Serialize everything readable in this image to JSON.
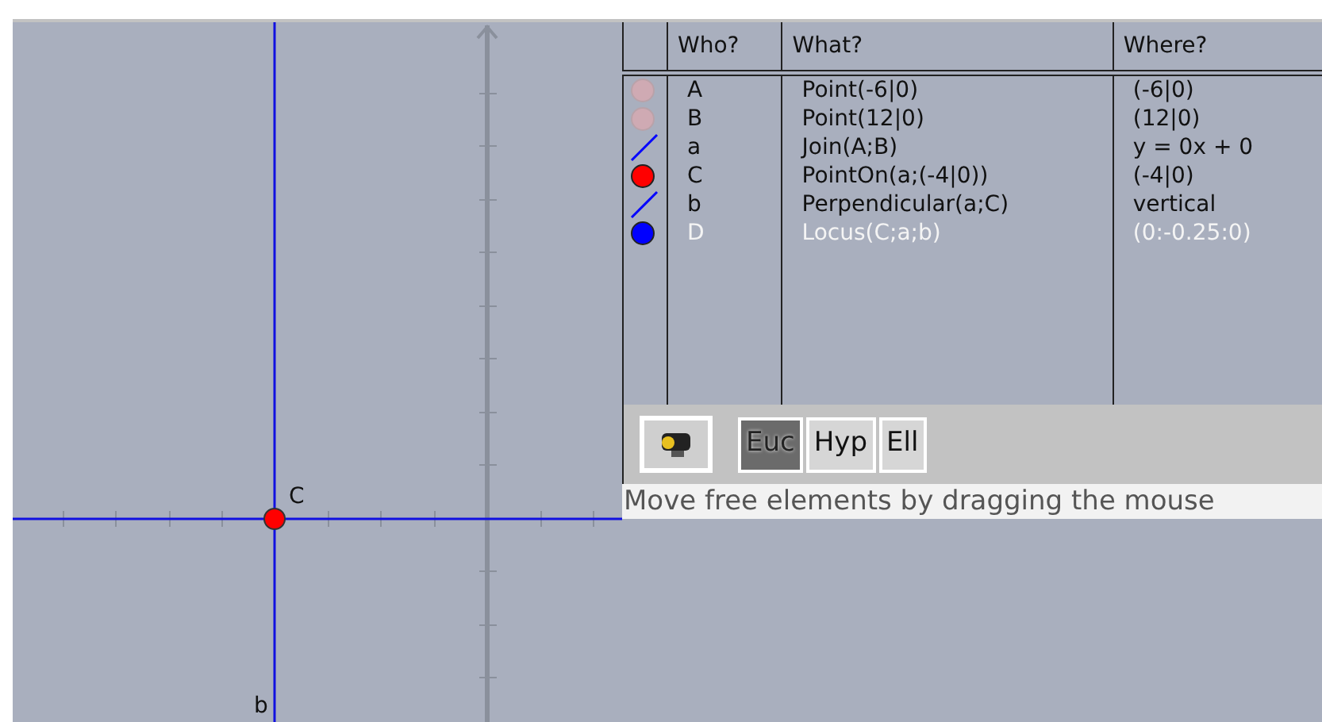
{
  "table": {
    "columns": [
      "Who?",
      "What?",
      "Where?"
    ],
    "rows": [
      {
        "kind": "point",
        "color": "#cfaab3",
        "who": "A",
        "what": "Point(-6|0)",
        "where": "(-6|0)",
        "highlighted": false
      },
      {
        "kind": "point",
        "color": "#cfaab3",
        "who": "B",
        "what": "Point(12|0)",
        "where": "(12|0)",
        "highlighted": false
      },
      {
        "kind": "line",
        "color": "#0000ff",
        "who": "a",
        "what": "Join(A;B)",
        "where": "y = 0x  + 0",
        "highlighted": false
      },
      {
        "kind": "point",
        "color": "#ff0000",
        "who": "C",
        "what": "PointOn(a;(-4|0))",
        "where": "(-4|0)",
        "highlighted": false
      },
      {
        "kind": "line",
        "color": "#0000ff",
        "who": "b",
        "what": "Perpendicular(a;C)",
        "where": "vertical",
        "highlighted": false
      },
      {
        "kind": "point",
        "color": "#0000ff",
        "who": "D",
        "what": "Locus(C;a;b)",
        "where": "(0:-0.25:0)",
        "highlighted": true
      }
    ]
  },
  "geometry_buttons": [
    {
      "label": "Euc",
      "selected": true
    },
    {
      "label": "Hyp",
      "selected": false
    },
    {
      "label": "Ell",
      "selected": false
    }
  ],
  "status_bar": "Move free elements by dragging the mouse",
  "canvas": {
    "labels": [
      {
        "text": "C"
      },
      {
        "text": "b"
      }
    ]
  }
}
